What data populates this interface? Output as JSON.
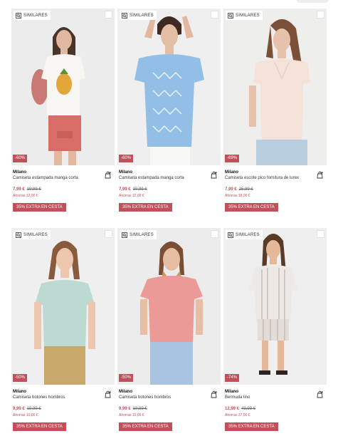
{
  "similares_label": "SIMILARES",
  "colors": {
    "accent": "#c0505a"
  },
  "products": [
    {
      "discount": "-60%",
      "brand": "Milano",
      "name": "Camiseta estampada manga corta",
      "price": "7,99 €",
      "old_price": "19,99 €",
      "savings": "Ahorras 12,00 €",
      "promo": "35% EXTRA EN CESTA"
    },
    {
      "discount": "-60%",
      "brand": "Milano",
      "name": "Camiseta estampada manga corta",
      "price": "7,99 €",
      "old_price": "19,99 €",
      "savings": "Ahorras 12,00 €",
      "promo": "35% EXTRA EN CESTA"
    },
    {
      "discount": "-69%",
      "brand": "Milano",
      "name": "Camiseta escote pico fornitura de lurex",
      "price": "7,99 €",
      "old_price": "25,99 €",
      "savings": "Ahorras 18,00 €",
      "promo": "35% EXTRA EN CESTA"
    },
    {
      "discount": "-50%",
      "brand": "Milano",
      "name": "Camiseta botones hombros",
      "price": "9,99 €",
      "old_price": "19,99 €",
      "savings": "Ahorras 10,00 €",
      "promo": "35% EXTRA EN CESTA"
    },
    {
      "discount": "-50%",
      "brand": "Milano",
      "name": "Camiseta botones hombros",
      "price": "9,99 €",
      "old_price": "19,99 €",
      "savings": "Ahorras 10,00 €",
      "promo": "35% EXTRA EN CESTA"
    },
    {
      "discount": "-74%",
      "brand": "Milano",
      "name": "Bermuda lino",
      "price": "12,99 €",
      "old_price": "49,99 €",
      "savings": "Ahorras 37,00 €",
      "promo": "35% EXTRA EN CESTA"
    }
  ]
}
